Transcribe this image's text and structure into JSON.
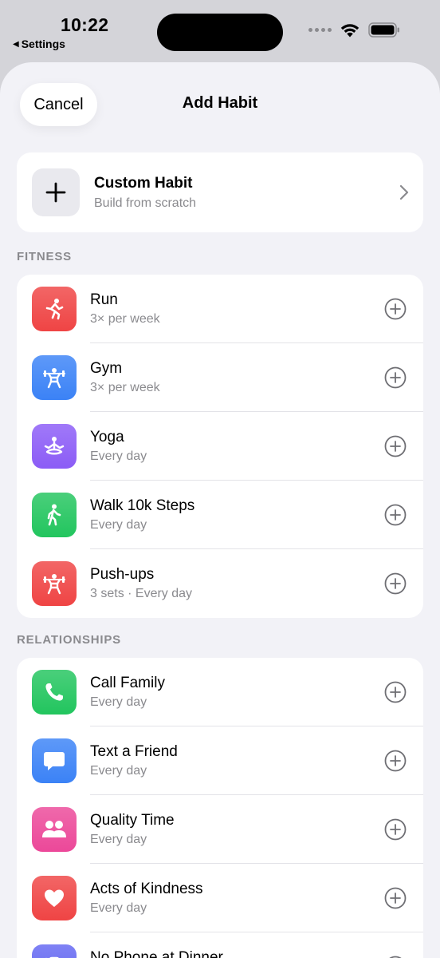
{
  "status": {
    "time": "10:22",
    "back_label": "Settings"
  },
  "header": {
    "cancel": "Cancel",
    "title": "Add Habit"
  },
  "custom": {
    "title": "Custom Habit",
    "subtitle": "Build from scratch"
  },
  "sections": {
    "fitness": {
      "title": "FITNESS",
      "items": [
        {
          "title": "Run",
          "subtitle": "3× per week",
          "icon": "running-person-icon",
          "color": "#ef4444"
        },
        {
          "title": "Gym",
          "subtitle": "3× per week",
          "icon": "weightlifter-icon",
          "color": "#3b82f6"
        },
        {
          "title": "Yoga",
          "subtitle": "Every day",
          "icon": "meditation-icon",
          "color": "#8b5cf6"
        },
        {
          "title": "Walk 10k Steps",
          "subtitle": "Every day",
          "icon": "walking-person-icon",
          "color": "#22c55e"
        },
        {
          "title": "Push-ups",
          "subtitle": "3 sets · Every day",
          "icon": "weightlifter-icon",
          "color": "#ef4444"
        }
      ]
    },
    "relationships": {
      "title": "RELATIONSHIPS",
      "items": [
        {
          "title": "Call Family",
          "subtitle": "Every day",
          "icon": "phone-icon",
          "color": "#22c55e"
        },
        {
          "title": "Text a Friend",
          "subtitle": "Every day",
          "icon": "message-bubble-icon",
          "color": "#3b82f6"
        },
        {
          "title": "Quality Time",
          "subtitle": "Every day",
          "icon": "people-icon",
          "color": "#ec4899"
        },
        {
          "title": "Acts of Kindness",
          "subtitle": "Every day",
          "icon": "heart-icon",
          "color": "#ef4444"
        },
        {
          "title": "No Phone at Dinner",
          "subtitle": "",
          "icon": "no-phone-icon",
          "color": "#6366f1"
        }
      ]
    }
  }
}
